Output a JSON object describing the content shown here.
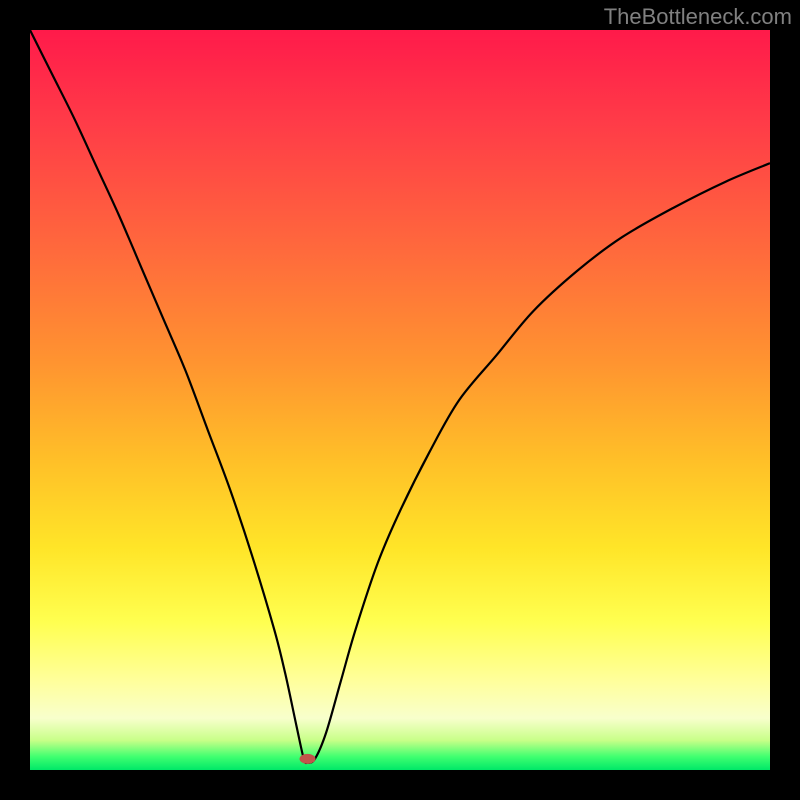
{
  "watermark": "TheBottleneck.com",
  "chart_data": {
    "type": "line",
    "title": "",
    "xlabel": "",
    "ylabel": "",
    "xlim": [
      0,
      100
    ],
    "ylim": [
      0,
      100
    ],
    "notch_x_pct": 37,
    "marker": {
      "x_pct": 37.5,
      "y_pct": 98.5,
      "color": "#c1554b",
      "rx": 8,
      "ry": 5
    },
    "series": [
      {
        "name": "bottleneck-curve",
        "x": [
          0,
          3,
          6,
          9,
          12,
          15,
          18,
          21,
          24,
          27,
          30,
          33,
          34.5,
          36,
          37,
          37.5,
          38.5,
          40,
          42,
          44,
          47,
          50,
          54,
          58,
          63,
          68,
          74,
          80,
          87,
          94,
          100
        ],
        "values": [
          100,
          94,
          88,
          81.5,
          75,
          68,
          61,
          54,
          46,
          38,
          29,
          19,
          13,
          6,
          1.5,
          1,
          1.5,
          5,
          12,
          19,
          28,
          35,
          43,
          50,
          56,
          62,
          67.5,
          72,
          76,
          79.5,
          82
        ]
      }
    ]
  }
}
